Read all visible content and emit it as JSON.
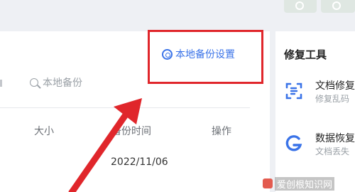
{
  "header": {
    "backup_settings_label": "本地备份设置"
  },
  "toolbar": {
    "search_placeholder": "本地备份"
  },
  "table": {
    "columns": [
      "大小",
      "备份时间",
      "操作"
    ],
    "rows": [
      {
        "time": "2022/11/06"
      }
    ]
  },
  "sidebar": {
    "title": "修复工具",
    "tools": [
      {
        "name": "文档修复",
        "desc": "修复乱码",
        "icon": "document-repair-icon"
      },
      {
        "name": "数据恢复",
        "desc": "文档丢失",
        "icon": "data-recovery-icon"
      }
    ]
  },
  "watermark": {
    "text": "爱创根知识网"
  },
  "colors": {
    "accent": "#3a73e8",
    "highlight": "#e0262b",
    "background": "#eef0f4",
    "panel": "#ffffff",
    "muted": "#9aa0a6"
  }
}
